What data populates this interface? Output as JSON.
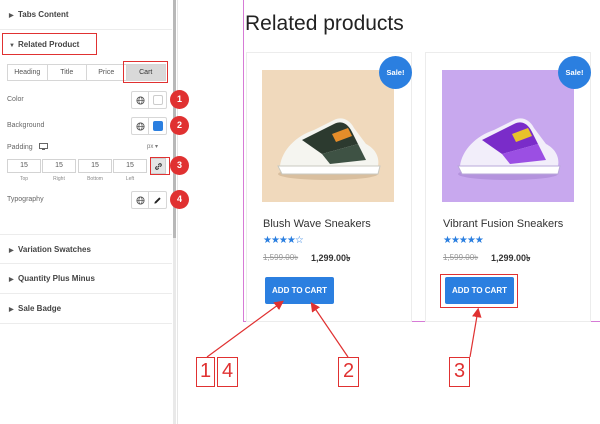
{
  "sidebar": {
    "sections": {
      "tabs_content": "Tabs Content",
      "related_product": "Related Product",
      "variation_swatches": "Variation Swatches",
      "quantity_plus_minus": "Quantity Plus Minus",
      "sale_badge": "Sale Badge"
    },
    "tabs": [
      "Heading",
      "Title",
      "Price",
      "Cart"
    ],
    "controls": {
      "color_label": "Color",
      "background_label": "Background",
      "padding_label": "Padding",
      "padding_unit": "px ▾",
      "typography_label": "Typography"
    },
    "padding": {
      "values": [
        "15",
        "15",
        "15",
        "15"
      ],
      "captions": [
        "Top",
        "Right",
        "Bottom",
        "Left"
      ]
    },
    "colors": {
      "color_swatch": "#ffffff",
      "background_swatch": "#2b7fe0"
    }
  },
  "badges": [
    "1",
    "2",
    "3",
    "4"
  ],
  "preview": {
    "title": "Related products",
    "products": [
      {
        "name": "Blush Wave Sneakers",
        "sale": "Sale!",
        "rating": 4,
        "stars": "★★★★☆",
        "old_price": "1,599.00৳",
        "new_price": "1,299.00৳",
        "cart_label": "ADD TO CART",
        "image_bg": "#f0d9bc"
      },
      {
        "name": "Vibrant Fusion Sneakers",
        "sale": "Sale!",
        "rating": 5,
        "stars": "★★★★★",
        "old_price": "1,599.00৳",
        "new_price": "1,299.00৳",
        "cart_label": "ADD TO CART",
        "image_bg": "#c8a8ee"
      }
    ]
  },
  "callouts": [
    "1",
    "4",
    "2",
    "3"
  ],
  "colors": {
    "accent_blue": "#2b7fe0",
    "annotation_red": "#e03131",
    "preview_border": "#d67bd6"
  }
}
